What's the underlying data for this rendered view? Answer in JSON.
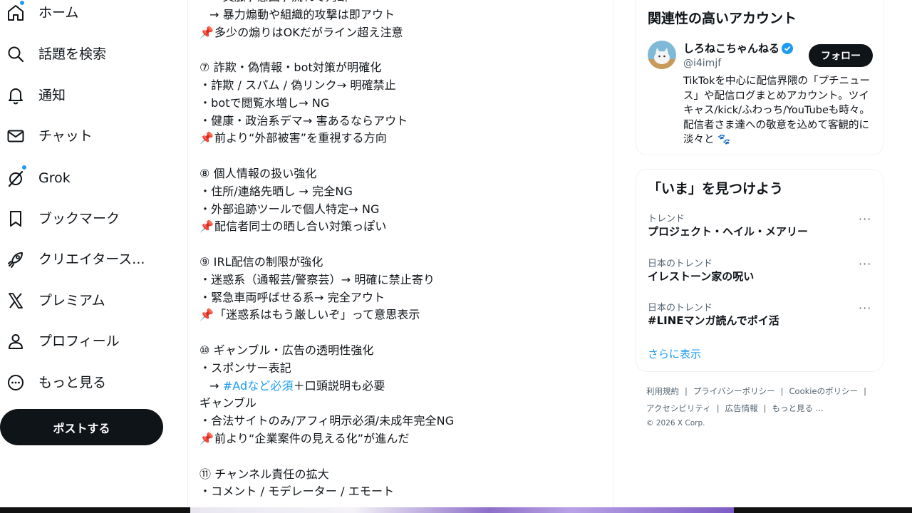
{
  "nav": {
    "items": [
      {
        "id": "home",
        "label": "ホーム",
        "icon": "home-icon",
        "has_dot": true
      },
      {
        "id": "explore",
        "label": "話題を検索",
        "icon": "search-icon",
        "has_dot": false
      },
      {
        "id": "notifications",
        "label": "通知",
        "icon": "bell-icon",
        "has_dot": false
      },
      {
        "id": "chat",
        "label": "チャット",
        "icon": "mail-icon",
        "has_dot": false
      },
      {
        "id": "grok",
        "label": "Grok",
        "icon": "grok-icon",
        "has_dot": true
      },
      {
        "id": "bookmarks",
        "label": "ブックマーク",
        "icon": "bookmark-icon",
        "has_dot": false
      },
      {
        "id": "creator",
        "label": "クリエイタース...",
        "icon": "rocket-icon",
        "has_dot": false
      },
      {
        "id": "premium",
        "label": "プレミアム",
        "icon": "x-logo-icon",
        "has_dot": false
      },
      {
        "id": "profile",
        "label": "プロフィール",
        "icon": "person-icon",
        "has_dot": false
      },
      {
        "id": "more",
        "label": "もっと見る",
        "icon": "more-circle-icon",
        "has_dot": false
      }
    ],
    "post_button": "ポストする"
  },
  "post": {
    "lines": [
      {
        "text": "→ 文脈 / 意図 / 流れで判断",
        "indent": true,
        "pin": false
      },
      {
        "text": "→ 暴力煽動や組織的攻撃は即アウト",
        "indent": true,
        "pin": false
      },
      {
        "text": "多少の煽りはOKだがライン超え注意",
        "indent": false,
        "pin": true
      },
      {
        "text": "",
        "indent": false,
        "pin": false
      },
      {
        "text": "⑦ 詐欺・偽情報・bot対策が明確化",
        "indent": false,
        "pin": false
      },
      {
        "text": "・詐欺 / スパム / 偽リンク→ 明確禁止",
        "indent": false,
        "pin": false
      },
      {
        "text": "・botで閲覧水増し→ NG",
        "indent": false,
        "pin": false
      },
      {
        "text": "・健康・政治系デマ→ 害あるならアウト",
        "indent": false,
        "pin": false
      },
      {
        "text": "前より“外部被害”を重視する方向",
        "indent": false,
        "pin": true
      },
      {
        "text": "",
        "indent": false,
        "pin": false
      },
      {
        "text": "⑧ 個人情報の扱い強化",
        "indent": false,
        "pin": false
      },
      {
        "text": "・住所/連絡先晒し → 完全NG",
        "indent": false,
        "pin": false
      },
      {
        "text": "・外部追跡ツールで個人特定→ NG",
        "indent": false,
        "pin": false
      },
      {
        "text": "配信者同士の晒し合い対策っぽい",
        "indent": false,
        "pin": true
      },
      {
        "text": "",
        "indent": false,
        "pin": false
      },
      {
        "text": "⑨ IRL配信の制限が強化",
        "indent": false,
        "pin": false
      },
      {
        "text": "・迷惑系（通報芸/警察芸）→ 明確に禁止寄り",
        "indent": false,
        "pin": false
      },
      {
        "text": "・緊急車両呼ばせる系→ 完全アウト",
        "indent": false,
        "pin": false
      },
      {
        "text": "「迷惑系はもう厳しいぞ」って意思表示",
        "indent": false,
        "pin": true
      },
      {
        "text": "",
        "indent": false,
        "pin": false
      },
      {
        "text": "⑩ ギャンブル・広告の透明性強化",
        "indent": false,
        "pin": false
      },
      {
        "text": "・スポンサー表記",
        "indent": false,
        "pin": false
      },
      {
        "text": "→ ",
        "indent": true,
        "pin": false,
        "hashtag": "#Adなど必須",
        "after": "＋口頭説明も必要"
      },
      {
        "text": "ギャンブル",
        "indent": false,
        "pin": false
      },
      {
        "text": "・合法サイトのみ/アフィ明示必須/未成年完全NG",
        "indent": false,
        "pin": false
      },
      {
        "text": "前より“企業案件の見える化”が進んだ",
        "indent": false,
        "pin": true
      },
      {
        "text": "",
        "indent": false,
        "pin": false
      },
      {
        "text": "⑪ チャンネル責任の拡大",
        "indent": false,
        "pin": false
      },
      {
        "text": "・コメント / モデレーター / エモート",
        "indent": false,
        "pin": false
      }
    ],
    "pin_glyph": "📌"
  },
  "recommended": {
    "title": "関連性の高いアカウント",
    "account": {
      "name": "しろねこちゃんねる",
      "handle": "@i4imjf",
      "verified": true,
      "follow_label": "フォロー",
      "bio": "TikTokを中心に配信界隈の「プチニュース」や配信ログまとめアカウント。ツイキャス/kick/ふわっち/YouTubeも時々。配信者さま達への敬意を込めて客観的に淡々と 🐾"
    }
  },
  "trends": {
    "title": "「いま」を見つけよう",
    "items": [
      {
        "context": "トレンド",
        "name": "プロジェクト・ヘイル・メアリー"
      },
      {
        "context": "日本のトレンド",
        "name": "イレストーン家の呪い"
      },
      {
        "context": "日本のトレンド",
        "name": "#LINEマンガ読んでポイ活"
      }
    ],
    "more_glyph": "···",
    "show_more": "さらに表示"
  },
  "footer": {
    "row1": [
      "利用規約",
      "プライバシーポリシー",
      "Cookieのポリシー"
    ],
    "row2": [
      "アクセシビリティ",
      "広告情報",
      "もっと見る ..."
    ],
    "copyright": "© 2026 X Corp."
  },
  "colors": {
    "accent": "#1d9bf0",
    "text": "#0f1419",
    "secondary": "#536471",
    "border": "#eff3f4"
  }
}
